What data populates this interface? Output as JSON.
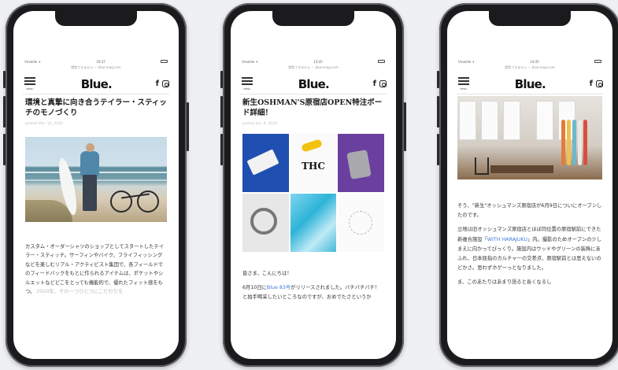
{
  "phones": [
    {
      "status": {
        "carrier": "Vmobile ✦",
        "time": "19:37"
      },
      "url": "閲覧できません — blue-mag.com",
      "site": {
        "logo": "Blue.",
        "menu_label": "MENU",
        "facebook": "f"
      },
      "article": {
        "title": "環境と真摯に向き合うテイラー・スティッチのモノづくり",
        "date": "posted Mar. 10, 2020",
        "body": "カスタム・オーダーシャツのショップとしてスタートしたテイラー・スティッチ。サーフィンやバイク、フライフィッシングなどを楽しむリアル・アクティビスト集団で、各フィールドでのフィードバックをもとに作られるアイテムは、ポケットやシルエットなどどこをとっても機能的で、優れたフィット感をもつ。",
        "fade": "2020年、その一つひとつにこだわりを"
      }
    },
    {
      "status": {
        "carrier": "Vmobile ✦",
        "time": "14:45"
      },
      "url": "閲覧できません — blue-mag.com",
      "site": {
        "logo": "Blue.",
        "menu_label": "MENU",
        "facebook": "f"
      },
      "article": {
        "title": "新生OSHMAN'S原宿店OPEN特注ボード詳細！",
        "date": "posted Jun. 9, 2020",
        "thc": "THC",
        "body_a": "皆さま、こんにちは！",
        "body_b1": "6月10日に",
        "link": "Blue 83号",
        "body_b2": "がリリースされました。バチバチバチ！ と拍手喝采したいところなのですが、おめでたさというか",
        "fade": ""
      }
    },
    {
      "status": {
        "carrier": "Vmobile ✦",
        "time": "14:45"
      },
      "url": "閲覧できません — blue-mag.com",
      "site": {
        "logo": "Blue.",
        "menu_label": "MENU",
        "facebook": "f"
      },
      "article": {
        "p1": "そう、\"新生\"オッシュマンズ原宿店が6月9日についにオープンしたのです。",
        "p2a": "立地は旧オッシュマンズ原宿店とほぼ同位置の原宿駅前にできた新複合施設「",
        "link": "WITH HARAJUKU",
        "p2b": "」内。撮影のためオープンの少しまえに向かってびっくり。施設内はウッドやグリーンの装飾にあふれ、日本屈指のカルチャーの交差点、原宿駅前とは思えないのどかさ。思わずホゲーっとなりました。",
        "p3": "ま、このあたりはあまり語ると長くなるし"
      }
    }
  ]
}
